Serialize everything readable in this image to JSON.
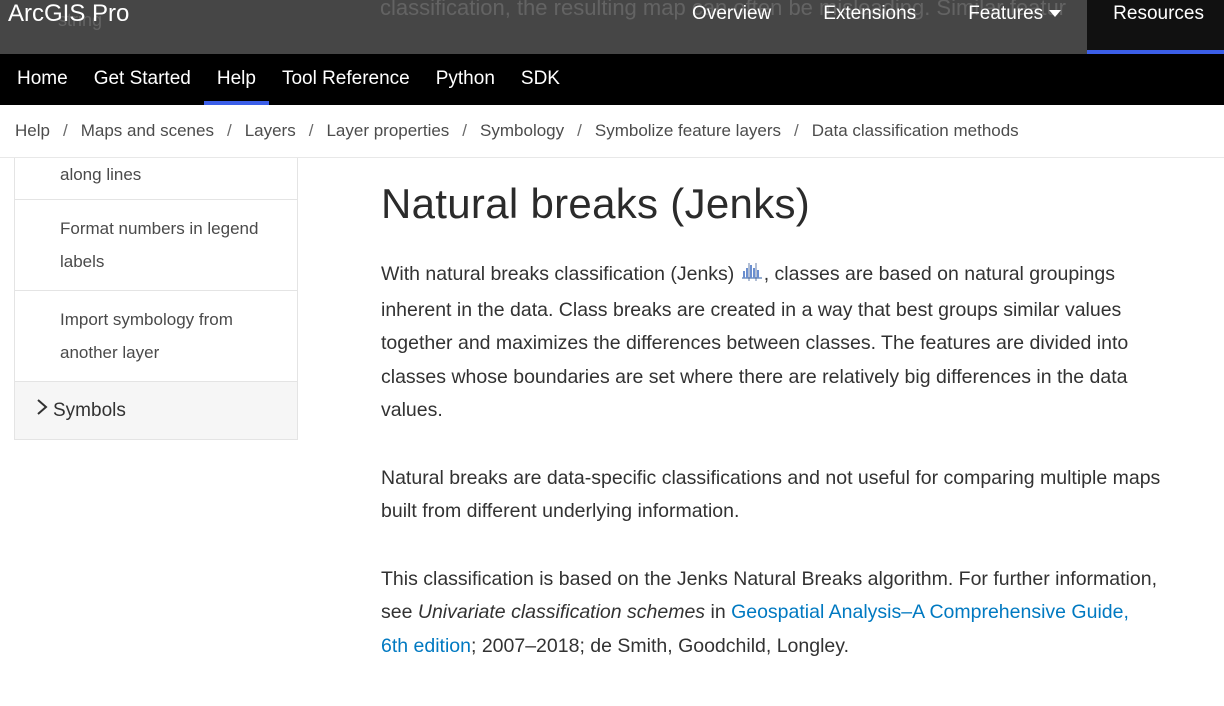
{
  "topbar": {
    "brand": "ArcGIS Pro",
    "ghost_text": "classification, the resulting map can often be misleading. Similar featur",
    "ghost_left": "string",
    "nav": [
      {
        "label": "Overview"
      },
      {
        "label": "Extensions"
      },
      {
        "label": "Features"
      },
      {
        "label": "Resources"
      }
    ]
  },
  "subnav": {
    "items": [
      {
        "label": "Home"
      },
      {
        "label": "Get Started"
      },
      {
        "label": "Help"
      },
      {
        "label": "Tool Reference"
      },
      {
        "label": "Python"
      },
      {
        "label": "SDK"
      }
    ],
    "active": "Help"
  },
  "breadcrumb": [
    "Help",
    "Maps and scenes",
    "Layers",
    "Layer properties",
    "Symbology",
    "Symbolize feature layers",
    "Data classification methods"
  ],
  "breadcrumb_separator": "/",
  "sidebar": {
    "items": [
      {
        "label": "along lines"
      },
      {
        "label": "Format numbers in legend labels"
      },
      {
        "label": "Import symbology from another layer"
      },
      {
        "label": "Symbols"
      }
    ]
  },
  "article": {
    "title": "Natural breaks (Jenks)",
    "p1_before_icon": "With natural breaks classification (Jenks) ",
    "p1_after_icon": ", classes are based on natural groupings inherent in the data. Class breaks are created in a way that best groups similar values together and maximizes the differences between classes. The features are divided into classes whose boundaries are set where there are relatively big differences in the data values.",
    "p2": "Natural breaks are data-specific classifications and not useful for comparing multiple maps built from different underlying information.",
    "p3_a": "This classification is based on the Jenks Natural Breaks algorithm. For further information, see ",
    "p3_italic": "Univariate classification schemes",
    "p3_b": " in ",
    "p3_link": "Geospatial Analysis–A Comprehensive Guide, 6th edition",
    "p3_c": "; 2007–2018; de Smith, Goodchild, Longley."
  },
  "colors": {
    "accent": "#3b5ee8",
    "link": "#0079c1",
    "topbar": "#282828",
    "subnav": "#000000"
  }
}
